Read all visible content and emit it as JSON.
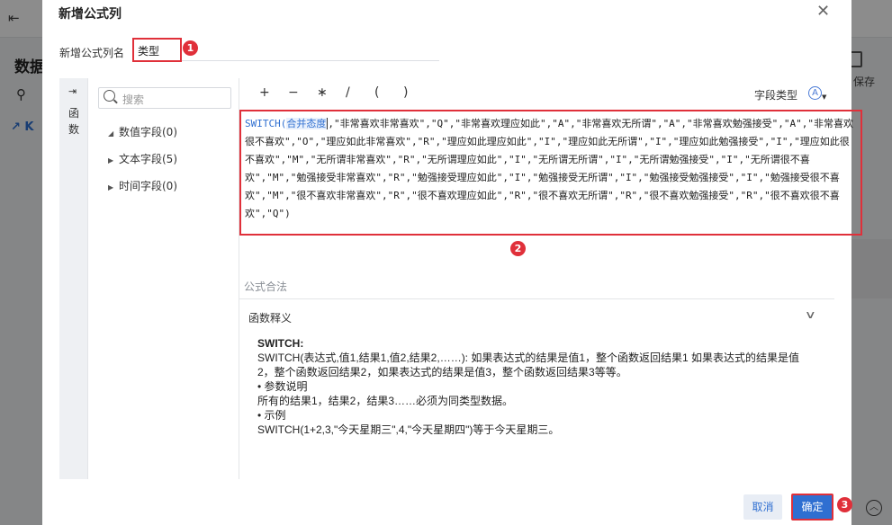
{
  "background": {
    "title_partial": "数据",
    "k_label": "K",
    "save_label": "保存"
  },
  "dialog": {
    "title": "新增公式列",
    "name_label": "新增公式列名",
    "name_value": "类型"
  },
  "badges": [
    "1",
    "2",
    "3"
  ],
  "left_tab": {
    "label": "函数"
  },
  "field_panel": {
    "search_placeholder": "搜索",
    "items": [
      {
        "label": "数值字段(0)",
        "expanded": true
      },
      {
        "label": "文本字段(5)",
        "expanded": false
      },
      {
        "label": "时间字段(0)",
        "expanded": false
      }
    ]
  },
  "operators": [
    "+",
    "−",
    "∗",
    "/",
    "(",
    ")"
  ],
  "field_type_label": "字段类型",
  "formula": {
    "fn": "SWITCH(",
    "field": "合并态度",
    "rest": ",\"非常喜欢非常喜欢\",\"Q\",\"非常喜欢理应如此\",\"A\",\"非常喜欢无所谓\",\"A\",\"非常喜欢勉强接受\",\"A\",\"非常喜欢很不喜欢\",\"O\",\"理应如此非常喜欢\",\"R\",\"理应如此理应如此\",\"I\",\"理应如此无所谓\",\"I\",\"理应如此勉强接受\",\"I\",\"理应如此很不喜欢\",\"M\",\"无所谓非常喜欢\",\"R\",\"无所谓理应如此\",\"I\",\"无所谓无所谓\",\"I\",\"无所谓勉强接受\",\"I\",\"无所谓很不喜欢\",\"M\",\"勉强接受非常喜欢\",\"R\",\"勉强接受理应如此\",\"I\",\"勉强接受无所谓\",\"I\",\"勉强接受勉强接受\",\"I\",\"勉强接受很不喜欢\",\"M\",\"很不喜欢非常喜欢\",\"R\",\"很不喜欢理应如此\",\"R\",\"很不喜欢无所谓\",\"R\",\"很不喜欢勉强接受\",\"R\",\"很不喜欢很不喜欢\",\"Q\")"
  },
  "validation_text": "公式合法",
  "explanation": {
    "header": "函数释义",
    "title": "SWITCH:",
    "line1": "SWITCH(表达式,值1,结果1,值2,结果2,……): 如果表达式的结果是值1，整个函数返回结果1 如果表达式的结果是值2，整个函数返回结果2，如果表达式的结果是值3，整个函数返回结果3等等。",
    "bullet1": "•  参数说明",
    "line2": "所有的结果1，结果2，结果3……必须为同类型数据。",
    "bullet2": "•  示例",
    "line3": "SWITCH(1+2,3,\"今天星期三\",4,\"今天星期四\")等于今天星期三。"
  },
  "buttons": {
    "cancel": "取消",
    "ok": "确定"
  },
  "colors": {
    "accent": "#2f6fd1",
    "highlight": "#e0303a"
  }
}
